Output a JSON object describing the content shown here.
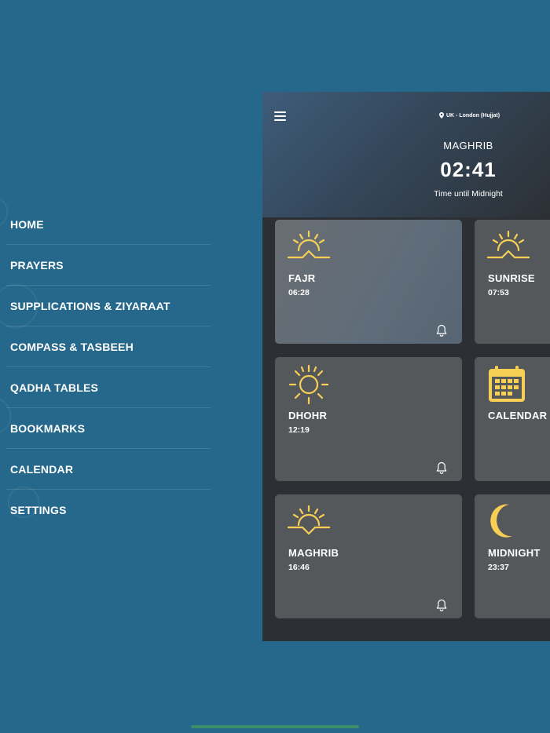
{
  "side_menu": {
    "items": [
      {
        "label": "HOME"
      },
      {
        "label": "PRAYERS"
      },
      {
        "label": "SUPPLICATIONS & ZIYARAAT"
      },
      {
        "label": "COMPASS & TASBEEH"
      },
      {
        "label": "QADHA TABLES"
      },
      {
        "label": "BOOKMARKS"
      },
      {
        "label": "CALENDAR"
      },
      {
        "label": "SETTINGS"
      }
    ]
  },
  "header": {
    "location": "UK - London (Hujjat)",
    "next_prayer": "MAGHRIB",
    "countdown": "02:41",
    "countdown_label": "Time until Midnight"
  },
  "cards": {
    "fajr": {
      "name": "FAJR",
      "time": "06:28",
      "icon": "sunrise-icon"
    },
    "sunrise": {
      "name": "SUNRISE",
      "time": "07:53",
      "icon": "sunrise-icon"
    },
    "dhohr": {
      "name": "DHOHR",
      "time": "12:19",
      "icon": "sun-icon"
    },
    "calendar": {
      "name": "CALENDAR",
      "icon": "calendar-icon"
    },
    "maghrib": {
      "name": "MAGHRIB",
      "time": "16:46",
      "icon": "sunset-icon"
    },
    "midnight": {
      "name": "MIDNIGHT",
      "time": "23:37",
      "icon": "moon-icon"
    }
  },
  "colors": {
    "background": "#25688b",
    "panel": "#2c3035",
    "card": "#55585b",
    "icon_yellow": "#f7cf55",
    "home_indicator": "#3c8d69"
  }
}
